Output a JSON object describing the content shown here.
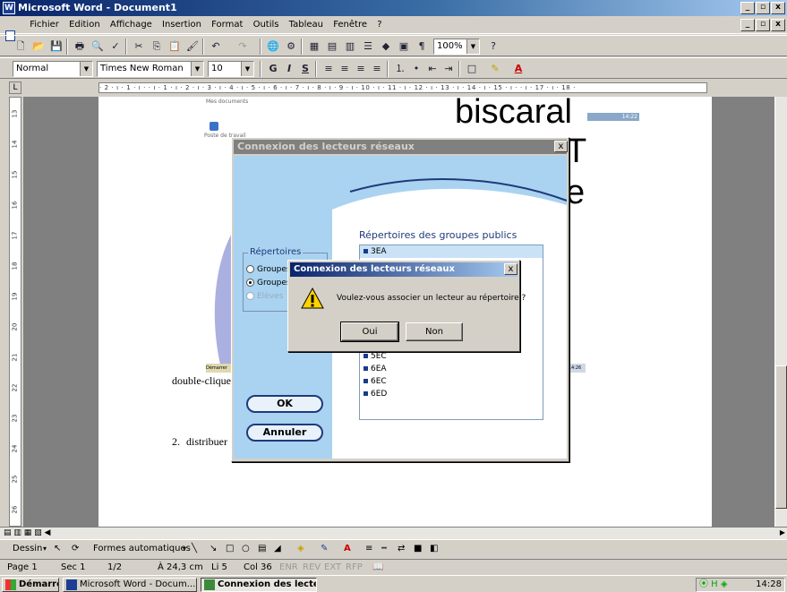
{
  "window": {
    "title": "Microsoft Word - Document1",
    "app_icon": "word-icon",
    "controls": [
      "_",
      "❒",
      "x"
    ]
  },
  "menu": [
    "Fichier",
    "Edition",
    "Affichage",
    "Insertion",
    "Format",
    "Outils",
    "Tableau",
    "Fenêtre",
    "?"
  ],
  "toolbar_standard": {
    "zoom": "100%"
  },
  "toolbar_format": {
    "style": "Normal",
    "font": "Times New Roman",
    "size": "10"
  },
  "ruler": {
    "horizontal": "· 2 · ı · 1 · ı ·   · ı · 1 · ı · 2 · ı · 3 · ı · 4 · ı · 5 · ı · 6 · ı · 7 · ı · 8 · ı · 9 · ı · 10 · ı · 11 · ı · 12 · ı · 13 · ı · 14 · ı · 15 · ı ·   · ı · 17 · ı · 18 ·",
    "vertical": [
      "13",
      "14",
      "15",
      "16",
      "17",
      "18",
      "19",
      "20",
      "21",
      "22",
      "23",
      "24",
      "25",
      "26"
    ]
  },
  "document": {
    "big_word_1": "biscaral",
    "big_word_2": "T",
    "big_word_3": "e",
    "bg_label_1": "Mes documents",
    "bg_label_2": "Poste de travail",
    "bg_clock": "14:22",
    "bg_clock_2": "14:26",
    "bg_demarrer": "Démarrer",
    "line_1": "double-cliquez",
    "line_2_num": "2.",
    "line_2_text": "distribuer"
  },
  "dialog_main": {
    "title": "Connexion des lecteurs réseaux",
    "group_label": "Répertoires",
    "radios": [
      {
        "label": "Groupes privés",
        "selected": false,
        "enabled": true
      },
      {
        "label": "Groupes publics",
        "selected": true,
        "enabled": true
      },
      {
        "label": "Elèves",
        "selected": false,
        "enabled": false
      }
    ],
    "list_title": "Répertoires des groupes publics",
    "list_items": [
      "3EA",
      "5EC",
      "6EA",
      "6EC",
      "6ED"
    ],
    "ok_label": "OK",
    "cancel_label": "Annuler"
  },
  "dialog_confirm": {
    "title": "Connexion des lecteurs réseaux",
    "message": "Voulez-vous associer un lecteur au répertoire ?",
    "yes_label": "Oui",
    "no_label": "Non",
    "icon": "warning-icon"
  },
  "drawing_bar": {
    "draw_label": "Dessin",
    "autoshapes_label": "Formes automatiques"
  },
  "status": {
    "page": "Page 1",
    "section": "Sec 1",
    "pages": "1/2",
    "position": "À 24,3 cm",
    "line": "Li 5",
    "column": "Col 36",
    "enr": "ENR",
    "rev": "REV",
    "ext": "EXT",
    "rfp": "RFP"
  },
  "taskbar": {
    "start_label": "Démarrer",
    "task_1": "Microsoft Word - Docum...",
    "task_2": "Connexion des lecteu...",
    "clock": "14:28"
  },
  "colors": {
    "title_active": "#0a246a",
    "title_inactive": "#808080",
    "dialog_blue": "#a9d3f0",
    "list_selected": "#c9e2f5",
    "warning_yellow": "#ffd200"
  }
}
